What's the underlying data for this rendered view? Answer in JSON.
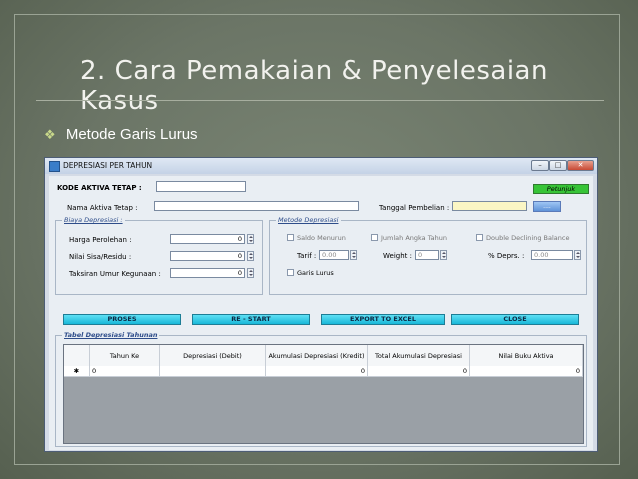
{
  "slide": {
    "title": "2. Cara Pemakaian & Penyelesaian Kasus",
    "bullet": "Metode Garis Lurus"
  },
  "window": {
    "title": "DEPRESIASI PER TAHUN",
    "kode_label": "KODE AKTIVA TETAP :",
    "petunjuk": "Petunjuk",
    "nama_label": "Nama Aktiva Tetap :",
    "tanggal_label": "Tanggal Pembelian :",
    "browse": "....",
    "biaya_group": "Biaya Depresiasi :",
    "harga_label": "Harga Perolehan :",
    "harga_value": "0",
    "nilai_sisa_label": "Nilai Sisa/Residu :",
    "nilai_sisa_value": "0",
    "umur_label": "Taksiran Umur Kegunaan :",
    "umur_value": "0",
    "metode_group": "Metode Depresiasi",
    "saldo_menurun": "Saldo Menurun",
    "jumlah_angka": "Jumlah Angka Tahun",
    "double_declining": "Double Declining Balance",
    "tarif_label": "Tarif :",
    "tarif_value": "0.00",
    "weight_label": "Weight :",
    "weight_value": "0",
    "depr_label": "% Deprs. :",
    "depr_value": "0.00",
    "garis_lurus": "Garis Lurus",
    "buttons": {
      "proses": "PROSES",
      "restart": "RE - START",
      "export": "EXPORT TO EXCEL",
      "close": "CLOSE"
    },
    "table_group": "Tabel Depresiasi Tahunan",
    "columns": [
      "Tahun Ke",
      "Depresiasi (Debit)",
      "Akumulasi Depresiasi (Kredit)",
      "Total Akumulasi Depresiasi",
      "Nilai Buku Aktiva"
    ],
    "row": {
      "marker": "✱",
      "tahun": "0",
      "depresiasi": "",
      "akumulasi": "0",
      "total": "0",
      "nilai_buku": "0"
    }
  }
}
